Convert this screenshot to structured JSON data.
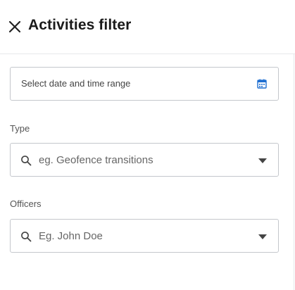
{
  "header": {
    "title": "Activities filter",
    "close_icon": "close-icon"
  },
  "date_range": {
    "placeholder": "Select date and time range",
    "icon": "calendar-icon",
    "icon_color": "#1f6fd1"
  },
  "type_filter": {
    "label": "Type",
    "placeholder": "eg. Geofence transitions",
    "icon": "search-icon"
  },
  "officers_filter": {
    "label": "Officers",
    "placeholder": "Eg. John Doe",
    "icon": "search-icon"
  }
}
